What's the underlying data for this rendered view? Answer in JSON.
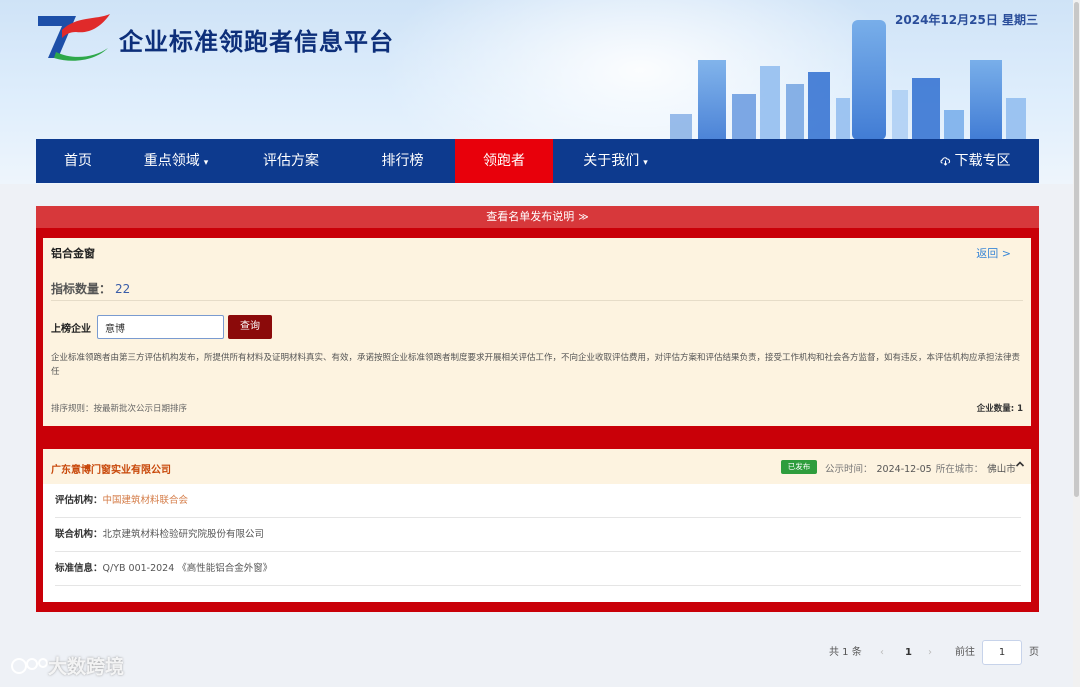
{
  "header": {
    "site_title": "企业标准领跑者信息平台",
    "date": "2024年12月25日 星期三"
  },
  "nav": {
    "items": [
      {
        "label": "首页",
        "dropdown": false
      },
      {
        "label": "重点领域",
        "dropdown": true
      },
      {
        "label": "评估方案",
        "dropdown": false
      },
      {
        "label": "排行榜",
        "dropdown": false
      },
      {
        "label": "领跑者",
        "dropdown": false,
        "active": true
      },
      {
        "label": "关于我们",
        "dropdown": true
      }
    ],
    "download": "下载专区",
    "caret": "▾"
  },
  "notice": {
    "label": "查看名单发布说明",
    "chevron": "≫"
  },
  "category": {
    "name": "铝合金窗",
    "back": "返回 >",
    "indicator_label": "指标数量：",
    "indicator_value": "22",
    "filter_label": "上榜企业",
    "search_value": "意博",
    "query_button": "查询",
    "disclaimer": "企业标准领跑者由第三方评估机构发布，所提供所有材料及证明材料真实、有效，承诺按照企业标准领跑者制度要求开展相关评估工作，不向企业收取评估费用，对评估方案和评估结果负责，接受工作机构和社会各方监督，如有违反，本评估机构应承担法律责任",
    "sort_rule": "排序规则：按最新批次公示日期排序",
    "company_count": "企业数量: 1"
  },
  "result": {
    "company": "广东意博门窗实业有限公司",
    "status": "已发布",
    "pub_label": "公示时间：",
    "pub_date": "2024-12-05",
    "city_label": "所在城市：",
    "city": "佛山市",
    "rows": [
      {
        "label": "评估机构：",
        "value": "中国建筑材料联合会"
      },
      {
        "label": "联合机构：",
        "value": "北京建筑材料检验研究院股份有限公司"
      },
      {
        "label": "标准信息：",
        "value": "Q/YB 001-2024 《高性能铝合金外窗》"
      }
    ]
  },
  "pagination": {
    "total": "共 1 条",
    "prev": "‹",
    "current": "1",
    "next": "›",
    "goto_label": "前往",
    "goto_value": "1",
    "page_suffix": "页"
  },
  "watermark": "大数跨境",
  "colors": {
    "nav_bg": "#0d3a8e",
    "active": "#e8000b",
    "frame": "#c90008",
    "badge": "#2e9d3d"
  }
}
